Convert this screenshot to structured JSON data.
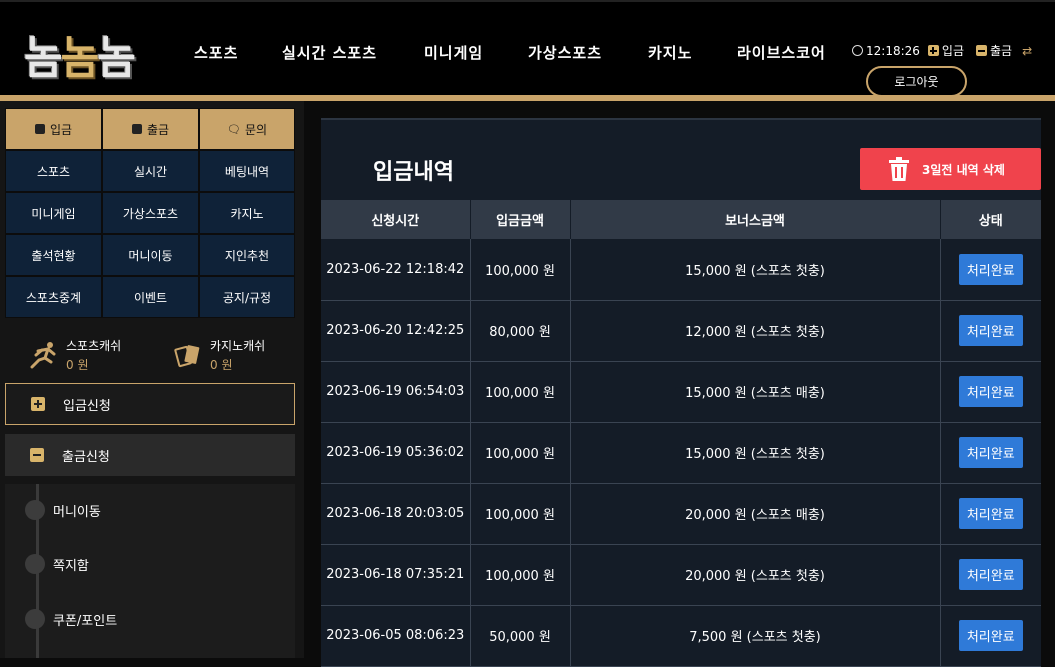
{
  "header": {
    "logo": [
      "놈",
      "놈",
      "놈"
    ],
    "nav": [
      "스포츠",
      "실시간 스포츠",
      "미니게임",
      "가상스포츠",
      "카지노",
      "라이브스코어"
    ],
    "time": "12:18:26",
    "deposit_label": "입금",
    "withdraw_label": "출금",
    "logout_label": "로그아웃",
    "accent_color": "#c9a46a"
  },
  "sidebar": {
    "top_buttons": [
      "입금",
      "출금",
      "문의"
    ],
    "grid_items": [
      "스포츠",
      "실시간",
      "베팅내역",
      "미니게임",
      "가상스포츠",
      "카지노",
      "출석현황",
      "머니이동",
      "지인추천",
      "스포츠중계",
      "이벤트",
      "공지/규정"
    ],
    "sports_cash_label": "스포츠캐쉬",
    "sports_cash_value": "0 원",
    "casino_cash_label": "카지노캐쉬",
    "casino_cash_value": "0 원",
    "deposit_request": "입금신청",
    "withdraw_request": "출금신청",
    "sub_items": [
      "머니이동",
      "쪽지함",
      "쿠폰/포인트"
    ]
  },
  "main": {
    "title": "입금내역",
    "delete_button": "3일전 내역 삭제",
    "columns": [
      "신청시간",
      "입금금액",
      "보너스금액",
      "상태"
    ],
    "rows": [
      {
        "time": "2023-06-22 12:18:42",
        "amount": "100,000 원",
        "bonus": "15,000 원 (스포츠 첫충)",
        "status": "처리완료"
      },
      {
        "time": "2023-06-20 12:42:25",
        "amount": "80,000 원",
        "bonus": "12,000 원 (스포츠 첫충)",
        "status": "처리완료"
      },
      {
        "time": "2023-06-19 06:54:03",
        "amount": "100,000 원",
        "bonus": "15,000 원 (스포츠 매충)",
        "status": "처리완료"
      },
      {
        "time": "2023-06-19 05:36:02",
        "amount": "100,000 원",
        "bonus": "15,000 원 (스포츠 첫충)",
        "status": "처리완료"
      },
      {
        "time": "2023-06-18 20:03:05",
        "amount": "100,000 원",
        "bonus": "20,000 원 (스포츠 매충)",
        "status": "처리완료"
      },
      {
        "time": "2023-06-18 07:35:21",
        "amount": "100,000 원",
        "bonus": "20,000 원 (스포츠 첫충)",
        "status": "처리완료"
      },
      {
        "time": "2023-06-05 08:06:23",
        "amount": "50,000 원",
        "bonus": "7,500 원 (스포츠 첫충)",
        "status": "처리완료"
      }
    ]
  }
}
